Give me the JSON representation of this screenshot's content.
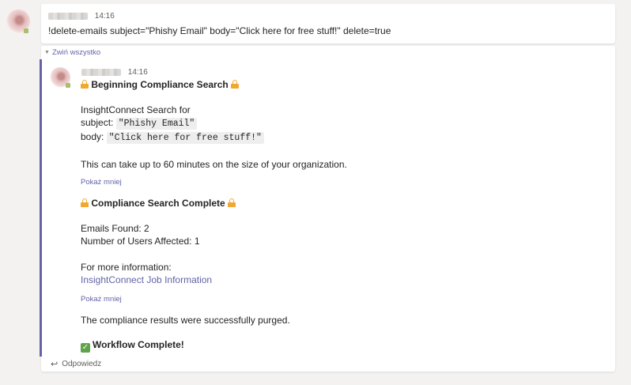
{
  "message": {
    "time": "14:16",
    "text": "!delete-emails subject=\"Phishy Email\" body=\"Click here for free stuff!\" delete=true"
  },
  "collapse_label": "Zwiń wszystko",
  "reply": {
    "time": "14:16",
    "heading1": "Beginning Compliance Search",
    "search_for": "InsightConnect Search for",
    "subject_label": "subject:",
    "subject_value": "\"Phishy Email\"",
    "body_label": "body:",
    "body_value": "\"Click here for free stuff!\"",
    "duration_note": "This can take up to 60 minutes on the size of your organization.",
    "show_less_1": "Pokaż mniej",
    "heading2": "Compliance Search Complete",
    "emails_found": "Emails Found: 2",
    "users_affected": "Number of Users Affected: 1",
    "more_info": "For more information:",
    "job_link": "InsightConnect Job Information",
    "show_less_2": "Pokaż mniej",
    "purged": "The compliance results were successfully purged.",
    "workflow_complete": "Workflow Complete!"
  },
  "reply_action": "Odpowiedz",
  "icons": {
    "lock": "lock-icon",
    "check": "check-mark-icon",
    "reply": "reply-arrow-icon",
    "collapse": "triangle-down-icon"
  },
  "colors": {
    "accent": "#6264a7",
    "lock": "#f0a830",
    "check": "#5fa34a",
    "background": "#f3f2f1"
  }
}
